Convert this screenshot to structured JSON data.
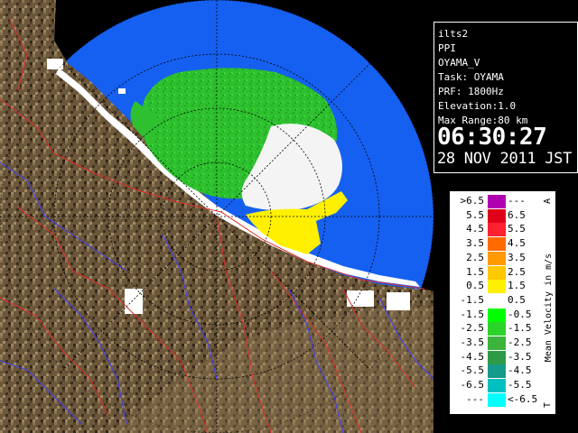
{
  "radar_info": {
    "site_id": "ilts2",
    "product": "PPI",
    "radar_name": "OYAMA_V",
    "task": "Task: OYAMA",
    "prf": "PRF: 1800Hz",
    "elevation": "Elevation:1.0",
    "max_range": "Max Range:80 km",
    "time": "06:30:27",
    "date": "28 NOV 2011 JST"
  },
  "legend": {
    "title": "Mean Velocity in m/s",
    "top_marker": "A",
    "bottom_marker": "T",
    "rows": [
      {
        "left": ">6.5",
        "right": "---",
        "color": "#b000b0"
      },
      {
        "left": "5.5",
        "right": "6.5",
        "color": "#e0001a"
      },
      {
        "left": "4.5",
        "right": "5.5",
        "color": "#ff2030"
      },
      {
        "left": "3.5",
        "right": "4.5",
        "color": "#ff6a00"
      },
      {
        "left": "2.5",
        "right": "3.5",
        "color": "#ff9a00"
      },
      {
        "left": "1.5",
        "right": "2.5",
        "color": "#ffc800"
      },
      {
        "left": "0.5",
        "right": "1.5",
        "color": "#fff000"
      },
      {
        "left": "-1.5",
        "right": "0.5",
        "color": "#ffffff"
      },
      {
        "left": "-1.5",
        "right": "-0.5",
        "color": "#00ff00"
      },
      {
        "left": "-2.5",
        "right": "-1.5",
        "color": "#2ad42a"
      },
      {
        "left": "-3.5",
        "right": "-2.5",
        "color": "#3cb43c"
      },
      {
        "left": "-4.5",
        "right": "-3.5",
        "color": "#2f9a46"
      },
      {
        "left": "-5.5",
        "right": "-4.5",
        "color": "#169a8a"
      },
      {
        "left": "-6.5",
        "right": "-5.5",
        "color": "#00c0c0"
      },
      {
        "left": "---",
        "right": "<-6.5",
        "color": "#00ffff"
      }
    ]
  },
  "map_colors": {
    "background": "#000000",
    "range_disk": "#1560f0",
    "terrain": "#6e5a3c",
    "echo_green": "#2ec02e",
    "echo_white": "#ffffff",
    "echo_yellow": "#fff000",
    "roads": "#e03030",
    "rivers": "#4040ff"
  }
}
